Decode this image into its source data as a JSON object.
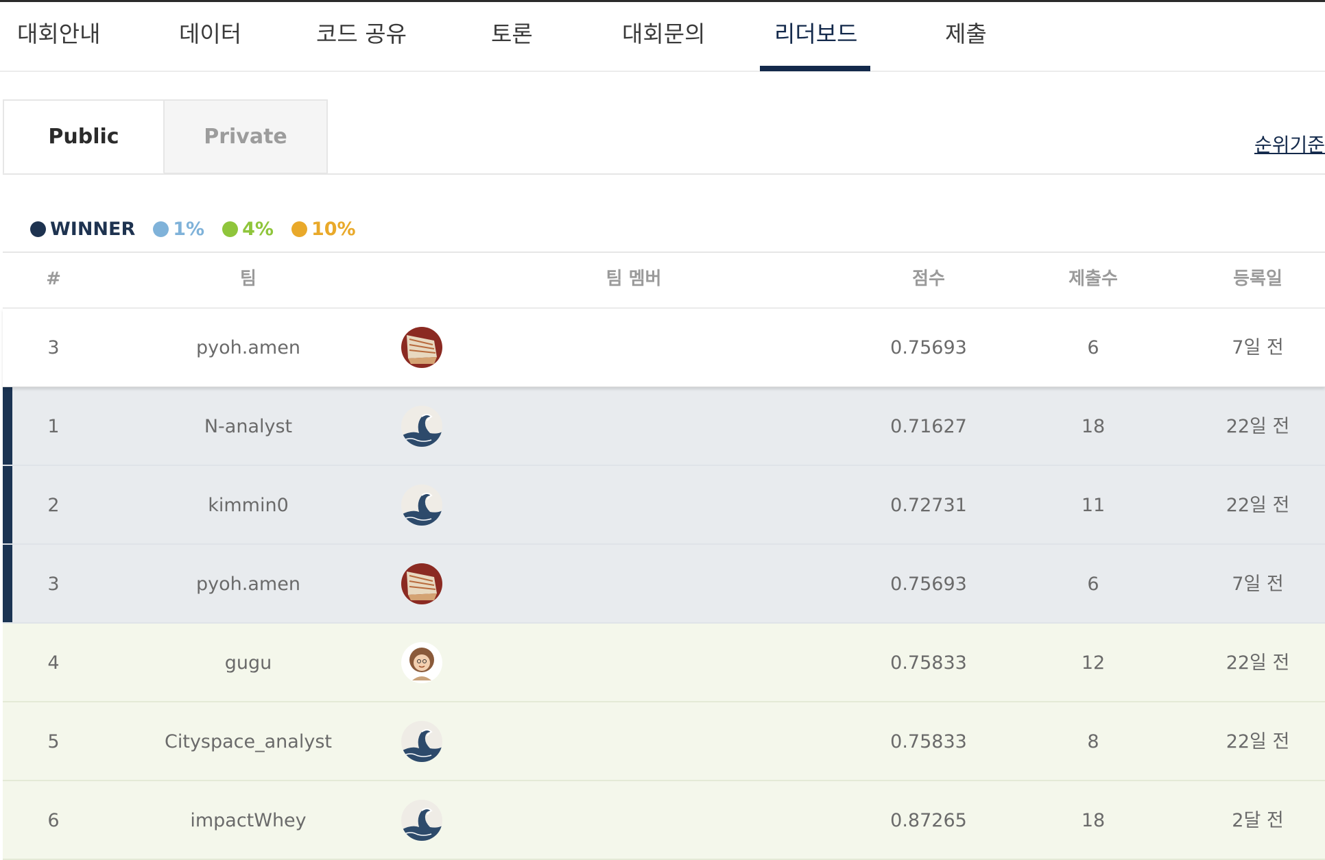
{
  "nav": {
    "items": [
      {
        "label": "대회안내"
      },
      {
        "label": "데이터"
      },
      {
        "label": "코드 공유"
      },
      {
        "label": "토론"
      },
      {
        "label": "대회문의"
      },
      {
        "label": "리더보드"
      },
      {
        "label": "제출"
      }
    ],
    "active": "리더보드"
  },
  "subtabs": {
    "public": "Public",
    "private": "Private",
    "active": "Public"
  },
  "rank_criteria": "순위기준",
  "legend": [
    {
      "label": "WINNER",
      "color": "#1e3350"
    },
    {
      "label": "1%",
      "color": "#7fb2d9"
    },
    {
      "label": "4%",
      "color": "#8fc53b"
    },
    {
      "label": "10%",
      "color": "#e9a92a"
    }
  ],
  "table": {
    "headers": {
      "rank": "#",
      "team": "팀",
      "members": "팀 멤버",
      "score": "점수",
      "submissions": "제출수",
      "date": "등록일"
    },
    "pinned": {
      "rank": "3",
      "team": "pyoh.amen",
      "avatar": "sailboat-avatar-icon",
      "score": "0.75693",
      "submissions": "6",
      "date": "7일 전"
    },
    "rows": [
      {
        "rank": "1",
        "team": "N-analyst",
        "avatar": "wave-avatar-icon",
        "score": "0.71627",
        "submissions": "18",
        "date": "22일 전",
        "tier": "winner"
      },
      {
        "rank": "2",
        "team": "kimmin0",
        "avatar": "wave-avatar-icon",
        "score": "0.72731",
        "submissions": "11",
        "date": "22일 전",
        "tier": "winner"
      },
      {
        "rank": "3",
        "team": "pyoh.amen",
        "avatar": "sailboat-avatar-icon",
        "score": "0.75693",
        "submissions": "6",
        "date": "7일 전",
        "tier": "winner"
      },
      {
        "rank": "4",
        "team": "gugu",
        "avatar": "person-avatar-icon",
        "score": "0.75833",
        "submissions": "12",
        "date": "22일 전",
        "tier": "pct4"
      },
      {
        "rank": "5",
        "team": "Cityspace_analyst",
        "avatar": "wave-avatar-icon",
        "score": "0.75833",
        "submissions": "8",
        "date": "22일 전",
        "tier": "pct4"
      },
      {
        "rank": "6",
        "team": "impactWhey",
        "avatar": "wave-avatar-icon",
        "score": "0.87265",
        "submissions": "18",
        "date": "2달 전",
        "tier": "pct4"
      }
    ]
  }
}
